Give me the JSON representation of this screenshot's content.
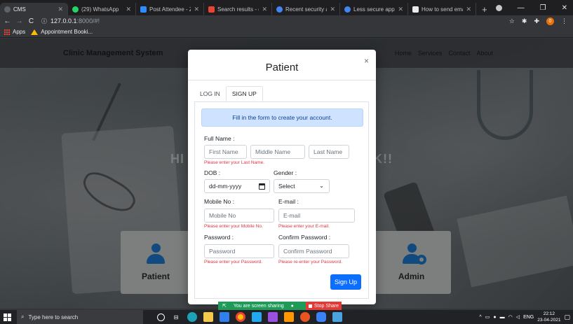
{
  "browser": {
    "tabs": [
      {
        "label": "CMS",
        "active": true,
        "favicon_color": "#5f6368"
      },
      {
        "label": "(29) WhatsApp",
        "active": false,
        "favicon_color": "#25d366"
      },
      {
        "label": "Post Attendee - Zoom",
        "active": false,
        "favicon_color": "#2d8cff"
      },
      {
        "label": "Search results - dheer",
        "active": false,
        "favicon_color": "#ea4335"
      },
      {
        "label": "Recent security activit",
        "active": false,
        "favicon_color": "#4285f4"
      },
      {
        "label": "Less secure app acces",
        "active": false,
        "favicon_color": "#4285f4"
      },
      {
        "label": "How to send emails u",
        "active": false,
        "favicon_color": "#e8eaed"
      }
    ],
    "new_tab": "+",
    "address": {
      "host": "127.0.0.1",
      "path": ":8000/#!"
    },
    "extension_badge": "0",
    "bookmarks": [
      {
        "label": "Apps",
        "icon": "apps-grid-icon"
      },
      {
        "label": "Appointment Booki...",
        "icon": "drive-icon"
      }
    ]
  },
  "site": {
    "brand": "Clinic Management System",
    "nav": [
      "Home",
      "Services",
      "Contact",
      "About"
    ],
    "hero_left": "HI",
    "hero_right": "K!!",
    "cards": {
      "patient": "Patient",
      "admin": "Admin"
    }
  },
  "modal": {
    "title": "Patient",
    "close": "×",
    "tabs": [
      {
        "label": "LOG IN",
        "active": false
      },
      {
        "label": "SIGN UP",
        "active": true
      }
    ],
    "alert": "Fill in the form to create your account.",
    "fullname": {
      "label": "Full Name :",
      "first": "First Name",
      "middle": "Middle Name",
      "last": "Last Name",
      "error": "Please enter your Last Name."
    },
    "dob": {
      "label": "DOB :",
      "placeholder": "dd-mm-yyyy"
    },
    "gender": {
      "label": "Gender :",
      "selected": "Select"
    },
    "mobile": {
      "label": "Mobile No :",
      "placeholder": "Mobile No",
      "error": "Please enter your Mobile No."
    },
    "email": {
      "label": "E-mail :",
      "placeholder": "E-mail",
      "error": "Please enter your E-mail."
    },
    "password": {
      "label": "Password :",
      "placeholder": "Password",
      "error": "Please enter your Password."
    },
    "confirm": {
      "label": "Confirm Password :",
      "placeholder": "Confirm Password",
      "error": "Please re-enter your Password."
    },
    "submit": "Sign Up"
  },
  "share_bar": {
    "sharing_text": "You are screen sharing",
    "stop_label": "Stop Share"
  },
  "taskbar": {
    "search_placeholder": "Type here to search",
    "lang": "ENG",
    "time": "22:12",
    "date": "23-04-2021"
  }
}
